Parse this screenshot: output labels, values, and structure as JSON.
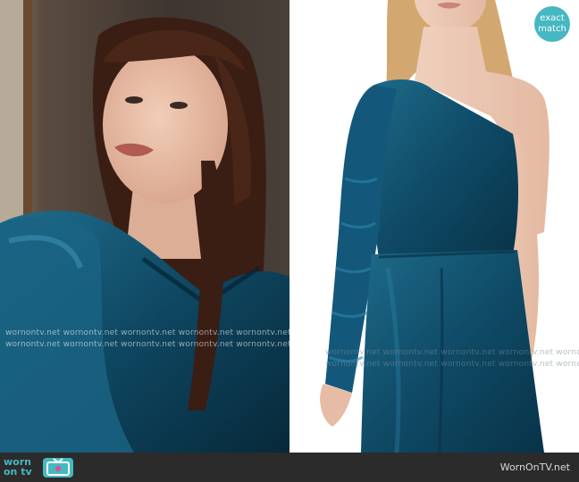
{
  "watermark": {
    "text": "wornontv.net",
    "left_rows": [
      "wornontv.net wornontv.net wornontv.net wornontv.net wornontv.net",
      "wornontv.net wornontv.net wornontv.net wornontv.net wornontv.net"
    ],
    "right_rows": [
      "wornontv.net wornontv.net wornontv.net wornontv.net wornontv.net",
      "wornontv.net wornontv.net wornontv.net wornontv.net wornontv.net"
    ]
  },
  "badge": {
    "line1": "exact",
    "line2": "match"
  },
  "footer": {
    "logo_line1": "worn",
    "logo_line2": "on tv",
    "site": "WornOnTV.net"
  },
  "colors": {
    "accent": "#45b8c2",
    "velvet": "#0f4a66",
    "footer_bg": "#2b2b2b"
  },
  "icons": [
    "tv-icon"
  ]
}
